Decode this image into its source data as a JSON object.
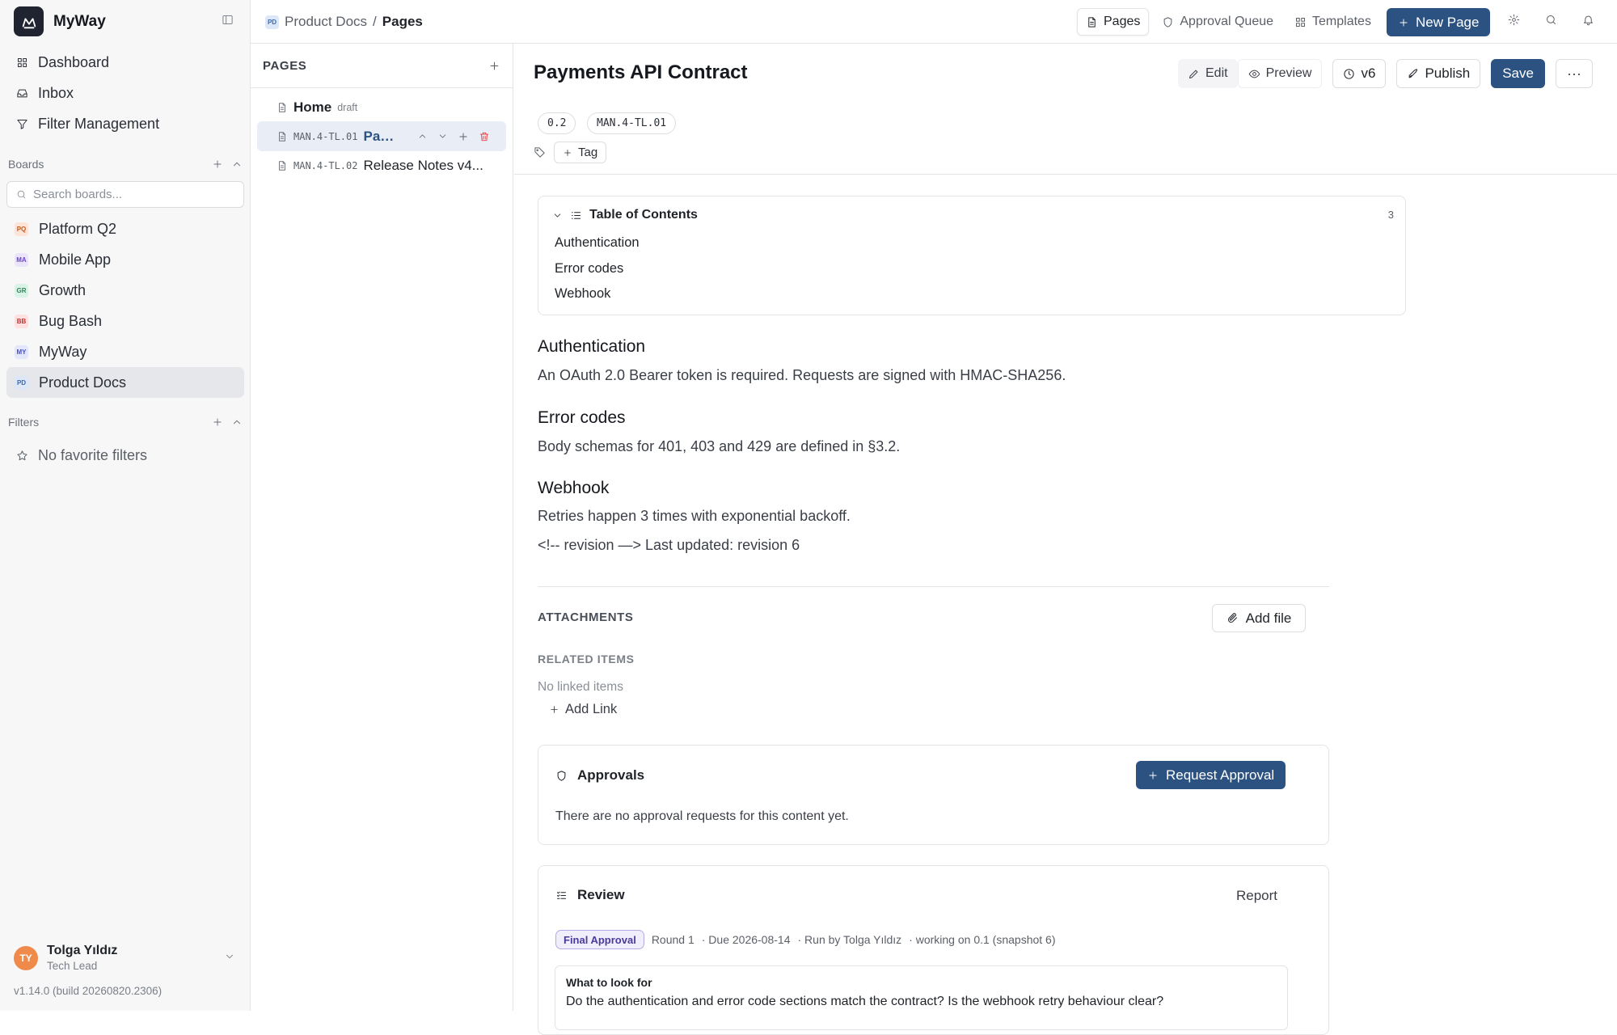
{
  "app": {
    "name": "MyWay",
    "version": "v1.14.0 (build 20260820.2306)"
  },
  "sidebar": {
    "nav": [
      {
        "label": "Dashboard",
        "icon": "grid-icon"
      },
      {
        "label": "Inbox",
        "icon": "inbox-icon"
      },
      {
        "label": "Filter Management",
        "icon": "filter-icon"
      }
    ],
    "boards_label": "Boards",
    "search_placeholder": "Search boards...",
    "boards": [
      {
        "label": "Platform Q2",
        "badge": "PQ",
        "bg": "#fde4d6",
        "fg": "#c25a1b"
      },
      {
        "label": "Mobile App",
        "badge": "MA",
        "bg": "#ece4fb",
        "fg": "#6b46c1"
      },
      {
        "label": "Growth",
        "badge": "GR",
        "bg": "#d9f3e6",
        "fg": "#2f855a"
      },
      {
        "label": "Bug Bash",
        "badge": "BB",
        "bg": "#fde0e0",
        "fg": "#c53030"
      },
      {
        "label": "MyWay",
        "badge": "MY",
        "bg": "#e3e7fb",
        "fg": "#4c51bf"
      },
      {
        "label": "Product Docs",
        "badge": "PD",
        "bg": "#dce7f7",
        "fg": "#3b68b0"
      }
    ],
    "filters_label": "Filters",
    "no_filters": "No favorite filters",
    "user": {
      "name": "Tolga Yıldız",
      "role": "Tech Lead",
      "initials": "TY"
    }
  },
  "topbar": {
    "breadcrumb": {
      "badge": "PD",
      "project": "Product Docs",
      "separator": "/",
      "current": "Pages"
    },
    "tabs": [
      {
        "label": "Pages",
        "icon": "document-icon"
      },
      {
        "label": "Approval Queue",
        "icon": "shield-icon"
      },
      {
        "label": "Templates",
        "icon": "grid-icon"
      }
    ],
    "new_page": "New Page"
  },
  "pages_panel": {
    "header": "PAGES",
    "items": [
      {
        "code": "",
        "title": "Home",
        "status": "draft"
      },
      {
        "code": "MAN.4-TL.01",
        "title": "Payments API Contract",
        "status": ""
      },
      {
        "code": "MAN.4-TL.02",
        "title": "Release Notes v4...",
        "status": ""
      }
    ]
  },
  "editor": {
    "title": "Payments API Contract",
    "toolbar": {
      "edit": "Edit",
      "preview": "Preview",
      "version": "v6",
      "publish": "Publish",
      "save": "Save",
      "more": "···"
    },
    "chips": [
      "0.2",
      "MAN.4-TL.01"
    ],
    "tag_button": "Tag",
    "toc": {
      "title": "Table of Contents",
      "count": "3",
      "links": [
        "Authentication",
        "Error codes",
        "Webhook"
      ]
    },
    "sections": [
      {
        "heading": "Authentication",
        "paragraphs": [
          "An OAuth 2.0 Bearer token is required. Requests are signed with HMAC-SHA256."
        ]
      },
      {
        "heading": "Error codes",
        "paragraphs": [
          "Body schemas for 401, 403 and 429 are defined in §3.2."
        ]
      },
      {
        "heading": "Webhook",
        "paragraphs": [
          "Retries happen 3 times with exponential backoff.",
          "<!-- revision —> Last updated: revision 6"
        ]
      }
    ],
    "attachments": {
      "label": "ATTACHMENTS",
      "add_file": "Add file"
    },
    "related": {
      "label": "RELATED ITEMS",
      "empty": "No linked items",
      "add_link": "Add Link"
    },
    "approvals": {
      "title": "Approvals",
      "request": "Request Approval",
      "empty": "There are no approval requests for this content yet."
    },
    "review": {
      "title": "Review",
      "report": "Report",
      "pill": "Final Approval",
      "meta": [
        "Round 1",
        "· Due 2026-08-14",
        "· Run by Tolga Yıldız",
        "· working on 0.1 (snapshot 6)"
      ],
      "what_label": "What to look for",
      "what_text": "Do the authentication and error code sections match the contract? Is the webhook retry behaviour clear?"
    }
  },
  "colors": {
    "primary": "#2c5282",
    "sidebar_bg": "#f7f7f8",
    "selected_page_bg": "#e8edf6",
    "danger": "#e53e3e",
    "final_approval_pill": "#f1eefc"
  }
}
